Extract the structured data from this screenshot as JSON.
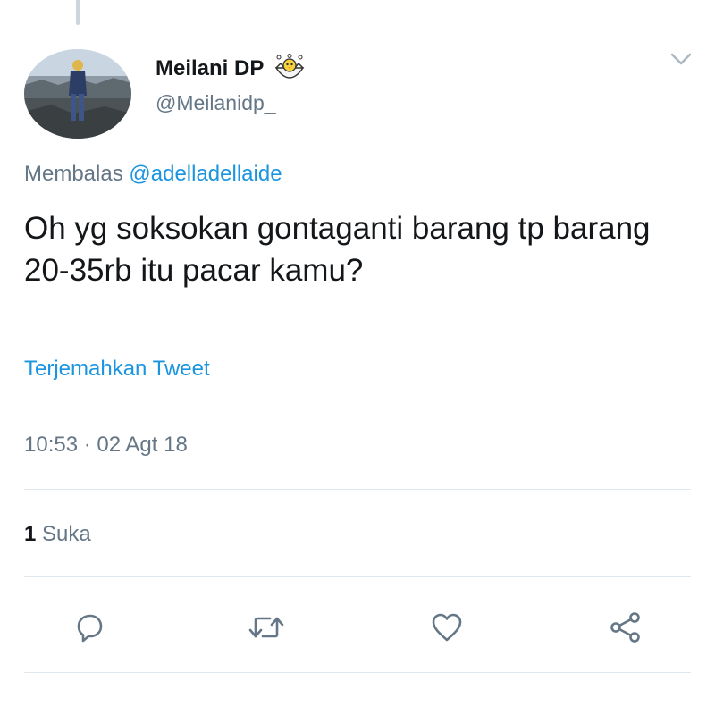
{
  "tweet": {
    "display_name": "Meilani DP",
    "handle": "@Meilanidp_",
    "reply_prefix": "Membalas",
    "reply_to": "@adelladellaide",
    "text": "Oh yg soksokan gontaganti barang tp barang 20-35rb itu pacar kamu?",
    "translate_label": "Terjemahkan Tweet",
    "timestamp": "10:53 · 02 Agt 18",
    "likes_count": "1",
    "likes_label": "Suka"
  },
  "icons": {
    "name_emoji": "hatching-chick-emoji",
    "menu": "chevron-down-icon",
    "actions": [
      "reply-icon",
      "retweet-icon",
      "like-icon",
      "share-icon"
    ]
  },
  "colors": {
    "link": "#1b95e0",
    "secondary_text": "#657786",
    "primary_text": "#14171a",
    "icon": "#657786",
    "divider": "#e1e8ed"
  }
}
